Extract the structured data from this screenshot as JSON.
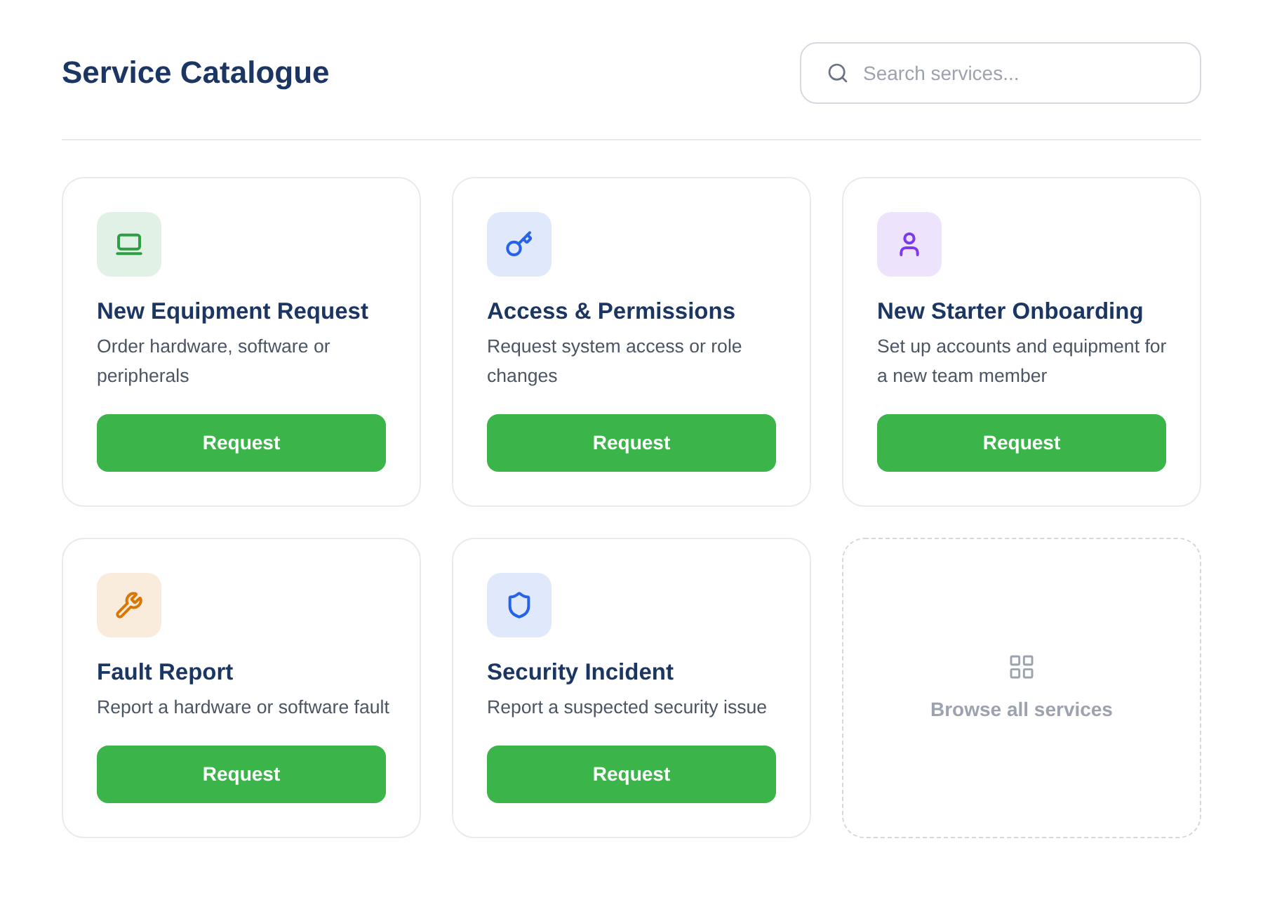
{
  "header": {
    "title": "Service Catalogue",
    "search": {
      "placeholder": "Search services..."
    }
  },
  "services": [
    {
      "title": "New Equipment Request",
      "description": "Order hardware, software or peripherals",
      "button": "Request",
      "color": "#2f9e44"
    },
    {
      "title": "Access & Permissions",
      "description": "Request system access or role changes",
      "button": "Request",
      "color": "#2563eb"
    },
    {
      "title": "New Starter Onboarding",
      "description": "Set up accounts and equipment for a new team member",
      "button": "Request",
      "color": "#7c3aed"
    },
    {
      "title": "Fault Report",
      "description": "Report a hardware or software fault",
      "button": "Request",
      "color": "#d97706"
    },
    {
      "title": "Security Incident",
      "description": "Report a suspected security issue",
      "button": "Request",
      "color": "#2563eb"
    }
  ],
  "browse_all": {
    "label": "Browse all services"
  }
}
